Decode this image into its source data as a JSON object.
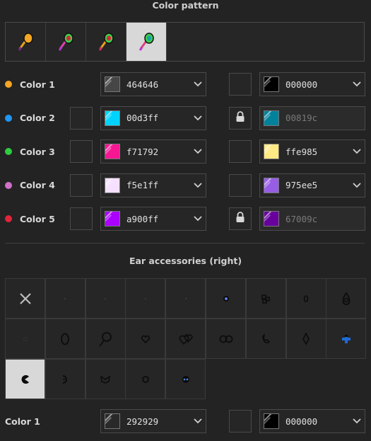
{
  "color_pattern": {
    "title": "Color pattern",
    "patterns": [
      {
        "icon": "balloon-orange-icon",
        "selected": false
      },
      {
        "icon": "balloon-green-pink-icon",
        "selected": false
      },
      {
        "icon": "balloon-green-orange-icon",
        "selected": false
      },
      {
        "icon": "balloon-green-red-icon",
        "selected": true
      }
    ]
  },
  "colors": [
    {
      "label": "Color 1",
      "dot": "#f5a623",
      "primary": {
        "hex": "464646",
        "swatch": "#464646"
      },
      "secondary": {
        "hex": "000000",
        "swatch": "#000000",
        "locked": false
      },
      "has_left_swatch": false
    },
    {
      "label": "Color 2",
      "dot": "#2196f3",
      "primary": {
        "hex": "00d3ff",
        "swatch": "#00d3ff"
      },
      "secondary": {
        "hex": "00819c",
        "swatch": "#00819c",
        "locked": true
      },
      "has_left_swatch": true
    },
    {
      "label": "Color 3",
      "dot": "#2ecc40",
      "primary": {
        "hex": "f71792",
        "swatch": "#f71792"
      },
      "secondary": {
        "hex": "ffe985",
        "swatch": "#ffe985",
        "locked": false
      },
      "has_left_swatch": true
    },
    {
      "label": "Color 4",
      "dot": "#d070c8",
      "primary": {
        "hex": "f5e1ff",
        "swatch": "#f5e1ff"
      },
      "secondary": {
        "hex": "975ee5",
        "swatch": "#975ee5",
        "locked": false
      },
      "has_left_swatch": true
    },
    {
      "label": "Color 5",
      "dot": "#e0243a",
      "primary": {
        "hex": "a900ff",
        "swatch": "#a900ff"
      },
      "secondary": {
        "hex": "67009c",
        "swatch": "#67009c",
        "locked": true
      },
      "has_left_swatch": true
    }
  ],
  "ear_accessories": {
    "title": "Ear accessories (right)",
    "items": [
      "none-x-icon",
      "tiny-dot-icon",
      "tiny-dot-icon",
      "tiny-dot-icon",
      "tiny-dot-icon",
      "blue-stud-icon",
      "clover-icon",
      "small-hoop-icon",
      "teardrop-hoop-icon",
      "faint-dot-icon",
      "oval-hoop-icon",
      "key-ring-icon",
      "heart-icon",
      "double-heart-icon",
      "double-ring-icon",
      "crescent-icon",
      "diamond-drop-icon",
      "blue-cross-icon",
      "pacman-icon",
      "half-moon-icon",
      "bow-icon",
      "ring-icon",
      "blue-face-icon"
    ],
    "selected_index": 18
  },
  "bottom_color": {
    "label": "Color 1",
    "primary": {
      "hex": "292929",
      "swatch": "#292929"
    },
    "secondary": {
      "hex": "000000",
      "swatch": "#000000"
    }
  }
}
